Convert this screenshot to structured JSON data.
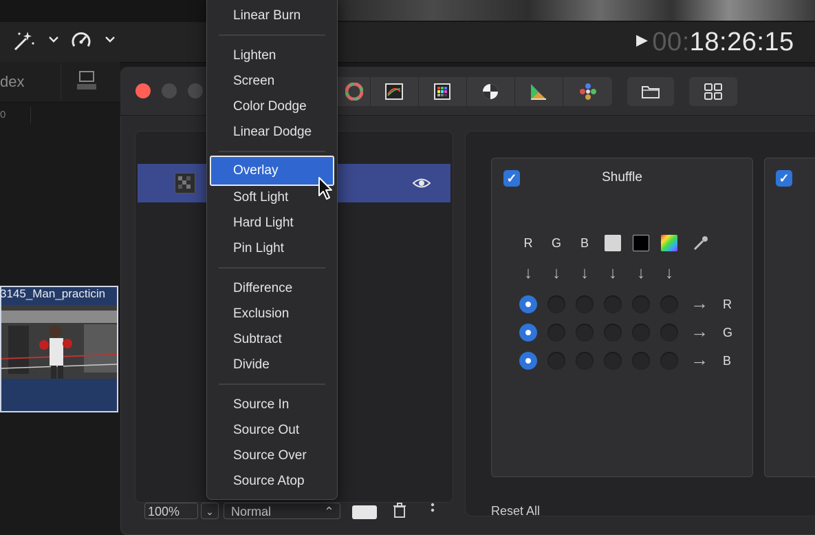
{
  "toolbar": {
    "timecode_dim": "00:",
    "timecode_main": "18:26:15",
    "enhance_icon": "magic-wand-icon",
    "speed_icon": "retime-gauge-icon"
  },
  "browser": {
    "index_label": "dex",
    "ruler_zero": "0",
    "clip_name": "3145_Man_practicin"
  },
  "menu": {
    "items_top": [
      "Linear Burn"
    ],
    "group_lighten": [
      "Lighten",
      "Screen",
      "Color Dodge",
      "Linear Dodge"
    ],
    "group_overlay": [
      "Overlay",
      "Soft Light",
      "Hard Light",
      "Pin Light"
    ],
    "group_difference": [
      "Difference",
      "Exclusion",
      "Subtract",
      "Divide"
    ],
    "group_source": [
      "Source In",
      "Source Out",
      "Source Over",
      "Source Atop"
    ],
    "selected": "Overlay"
  },
  "layers": {
    "opacity": "100%",
    "blend_mode": "Normal"
  },
  "effects": {
    "card_title": "Shuffle",
    "source_channels": [
      "R",
      "G",
      "B"
    ],
    "output_channels": [
      "R",
      "G",
      "B"
    ],
    "reset_label": "Reset All",
    "selection": [
      0,
      0,
      0
    ]
  },
  "colors": {
    "accent": "#2f74d8",
    "layer_highlight": "#3b4a8e",
    "close_button": "#ff5f57"
  }
}
